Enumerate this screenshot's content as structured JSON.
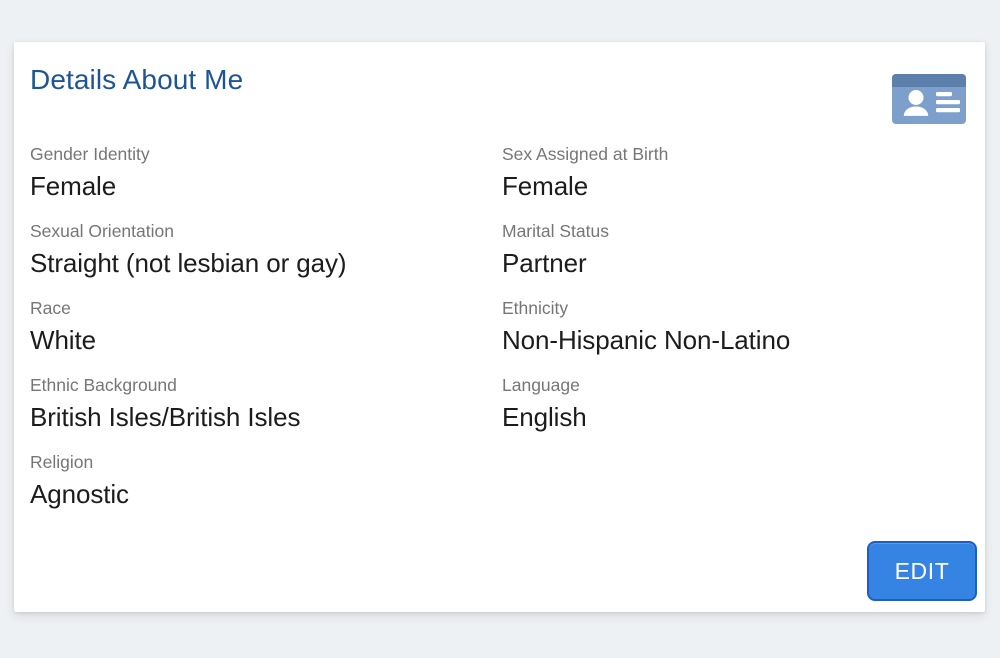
{
  "card": {
    "title": "Details About Me",
    "header_icon": "id-card-icon",
    "accent_color": "#1e5496",
    "label_color": "#767676",
    "value_color": "#1c1c1c",
    "page_background": "#eef1f3",
    "card_background": "#ffffff"
  },
  "fields_left": [
    {
      "label": "Gender Identity",
      "value": "Female"
    },
    {
      "label": "Sexual Orientation",
      "value": "Straight (not lesbian or gay)"
    },
    {
      "label": "Race",
      "value": "White"
    },
    {
      "label": "Ethnic Background",
      "value": "British Isles/British Isles"
    },
    {
      "label": "Religion",
      "value": "Agnostic"
    }
  ],
  "fields_right": [
    {
      "label": "Sex Assigned at Birth",
      "value": "Female"
    },
    {
      "label": "Marital Status",
      "value": "Partner"
    },
    {
      "label": "Ethnicity",
      "value": "Non-Hispanic Non-Latino"
    },
    {
      "label": "Language",
      "value": "English"
    }
  ],
  "actions": {
    "edit_label": "EDIT",
    "edit_fill": "#3584e4",
    "edit_border": "#1c5fc4",
    "edit_text_color": "#ffffff"
  }
}
